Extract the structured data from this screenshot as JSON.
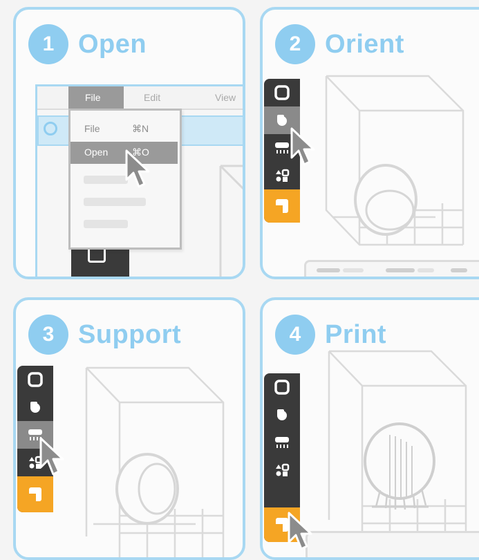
{
  "steps": [
    {
      "number": "1",
      "title": "Open"
    },
    {
      "number": "2",
      "title": "Orient"
    },
    {
      "number": "3",
      "title": "Support"
    },
    {
      "number": "4",
      "title": "Print"
    }
  ],
  "menubar": {
    "file": "File",
    "edit": "Edit",
    "view": "View"
  },
  "file_menu": {
    "items": [
      {
        "label": "File",
        "shortcut": "⌘N"
      },
      {
        "label": "Open",
        "shortcut": "⌘O"
      }
    ]
  },
  "icons": {
    "tool1": "box-outline-icon",
    "tool2": "orient-shapes-icon",
    "tool3": "support-tool-icon",
    "tool4": "layout-shapes-icon",
    "tool5": "print-layers-icon",
    "cursor": "arrow-cursor-icon"
  },
  "colors": {
    "accent": "#8fcdf0",
    "toolbar": "#3a3a3a",
    "print": "#f5a524"
  }
}
